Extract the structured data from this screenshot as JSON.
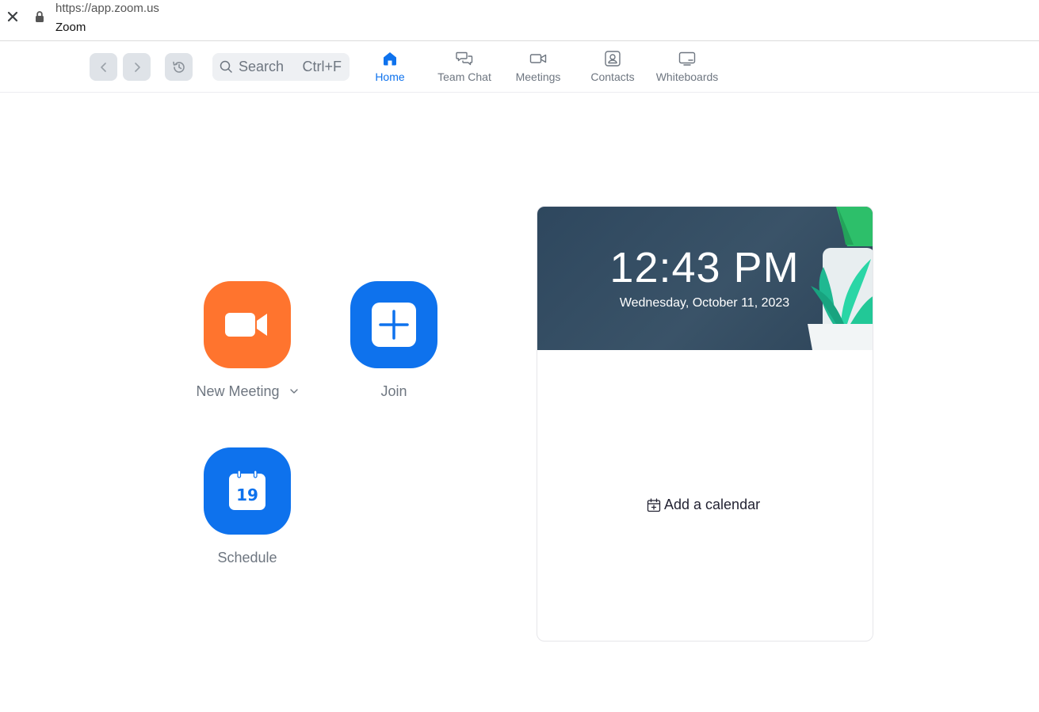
{
  "browser": {
    "url": "https://app.zoom.us",
    "title": "Zoom"
  },
  "toolbar": {
    "search_label": "Search",
    "search_shortcut": "Ctrl+F",
    "tabs": [
      {
        "label": "Home",
        "icon": "home-icon",
        "active": true
      },
      {
        "label": "Team Chat",
        "icon": "chat-bubbles-icon",
        "active": false
      },
      {
        "label": "Meetings",
        "icon": "video-camera-icon",
        "active": false
      },
      {
        "label": "Contacts",
        "icon": "contact-card-icon",
        "active": false
      },
      {
        "label": "Whiteboards",
        "icon": "whiteboard-icon",
        "active": false
      }
    ]
  },
  "actions": {
    "new_meeting": {
      "label": "New Meeting",
      "icon": "video-camera-icon",
      "color": "#ff742e"
    },
    "join": {
      "label": "Join",
      "icon": "plus-icon",
      "color": "#0e72ed"
    },
    "schedule": {
      "label": "Schedule",
      "icon": "calendar-icon",
      "day": "19",
      "color": "#0e72ed"
    }
  },
  "calendar_card": {
    "time": "12:43 PM",
    "date": "Wednesday, October 11, 2023",
    "add_calendar_label": "Add a calendar"
  },
  "colors": {
    "accent": "#0e72ed",
    "orange": "#ff742e",
    "muted_text": "#6e7680"
  }
}
